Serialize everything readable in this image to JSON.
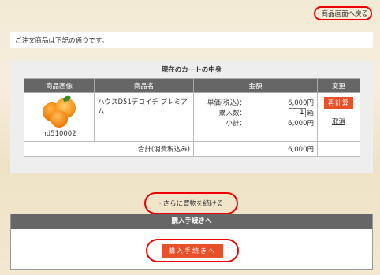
{
  "nav": {
    "back_label": "商品画面へ戻る"
  },
  "note": "ご注文商品は下記の通りです。",
  "cart": {
    "title": "現在のカートの中身",
    "headers": [
      "商品画像",
      "商品名",
      "金額",
      "変更"
    ],
    "item": {
      "code": "hd510002",
      "name": "ハウスD51デコイチ プレミアム",
      "unit_price_label": "単価(税込)：",
      "unit_price": "6,000円",
      "qty_label": "購入数：",
      "qty_value": "1",
      "qty_unit": "箱",
      "subtotal_label": "小計：",
      "subtotal": "6,000円",
      "recalc_label": "再計算",
      "cancel_label": "取消"
    },
    "total_label": "合計(消費税込み)",
    "total_value": "6,000円"
  },
  "continue_label": "さらに買物を続ける",
  "procedure": {
    "header": "購入手続きへ",
    "button_label": "購入手続きへ"
  }
}
